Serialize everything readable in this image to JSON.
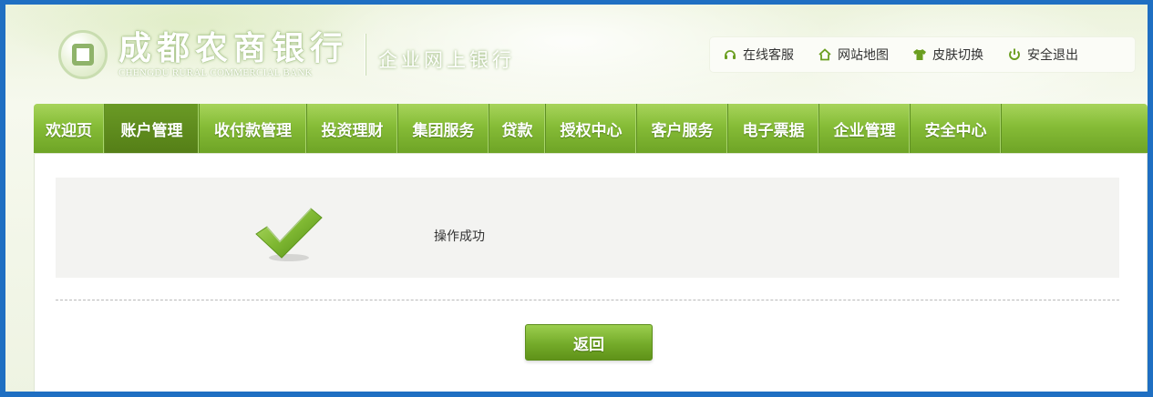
{
  "brand": {
    "name_cn": "成都农商银行",
    "name_en": "CHENGDU RURAL COMMERCIAL BANK",
    "product": "企业网上银行"
  },
  "toolbar": {
    "items": [
      {
        "label": "在线客服",
        "icon": "headset-icon"
      },
      {
        "label": "网站地图",
        "icon": "home-icon"
      },
      {
        "label": "皮肤切换",
        "icon": "shirt-icon"
      },
      {
        "label": "安全退出",
        "icon": "power-icon"
      }
    ]
  },
  "nav": {
    "items": [
      {
        "label": "欢迎页",
        "active": false
      },
      {
        "label": "账户管理",
        "active": true
      },
      {
        "label": "收付款管理",
        "active": false
      },
      {
        "label": "投资理财",
        "active": false
      },
      {
        "label": "集团服务",
        "active": false
      },
      {
        "label": "贷款",
        "active": false
      },
      {
        "label": "授权中心",
        "active": false
      },
      {
        "label": "客户服务",
        "active": false
      },
      {
        "label": "电子票据",
        "active": false
      },
      {
        "label": "企业管理",
        "active": false
      },
      {
        "label": "安全中心",
        "active": false
      }
    ]
  },
  "result": {
    "message": "操作成功",
    "icon": "checkmark-icon"
  },
  "actions": {
    "back_label": "返回"
  },
  "colors": {
    "frame_border": "#1f6fc2",
    "nav_green": "#86bc37",
    "nav_active": "#557f17",
    "button_green": "#74ab2a",
    "icon_green": "#6a9e1f"
  }
}
